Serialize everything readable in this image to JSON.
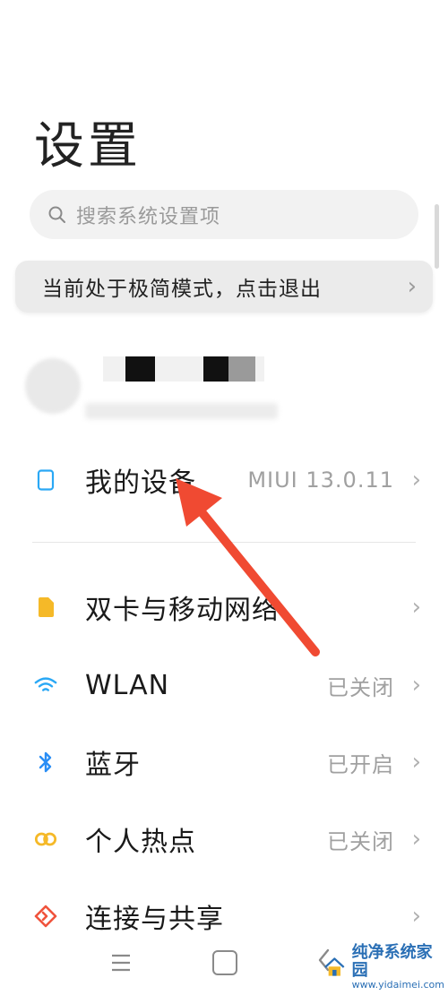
{
  "page": {
    "title": "设置"
  },
  "search": {
    "placeholder": "搜索系统设置项",
    "icon": "search-icon"
  },
  "simple_mode_banner": {
    "label": "当前处于极简模式，点击退出",
    "icon": "chevron-right-icon"
  },
  "device_row": {
    "label": "我的设备",
    "value": "MIUI 13.0.11",
    "icon": "phone-icon"
  },
  "settings": [
    {
      "label": "双卡与移动网络",
      "value": "",
      "icon": "sim-card-icon",
      "color": "#f5b928"
    },
    {
      "label": "WLAN",
      "value": "已关闭",
      "icon": "wifi-icon",
      "color": "#2aa8f5"
    },
    {
      "label": "蓝牙",
      "value": "已开启",
      "icon": "bluetooth-icon",
      "color": "#2a8ef5"
    },
    {
      "label": "个人热点",
      "value": "已关闭",
      "icon": "hotspot-icon",
      "color": "#f5b928"
    },
    {
      "label": "连接与共享",
      "value": "",
      "icon": "share-icon",
      "color": "#f0533c"
    }
  ],
  "watermark": {
    "title": "纯净系统家园",
    "url": "www.yidaimei.com"
  },
  "colors": {
    "annotation_arrow": "#f04a32",
    "accent_blue": "#2aa8f5"
  }
}
